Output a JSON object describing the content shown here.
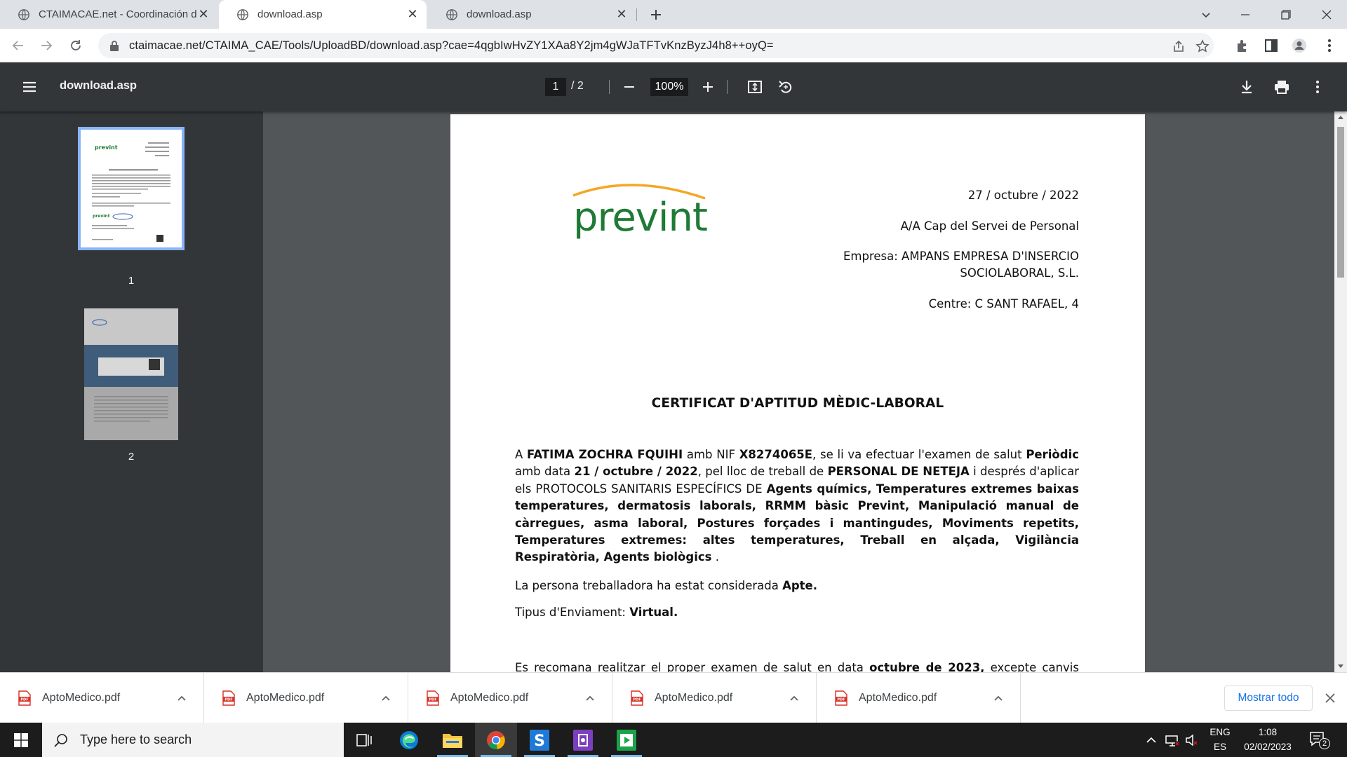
{
  "tabs": [
    {
      "title": "CTAIMACAE.net - Coordinación de Actividades Empresariales",
      "active": false
    },
    {
      "title": "download.asp",
      "active": true
    },
    {
      "title": "download.asp",
      "active": false
    }
  ],
  "address_bar": {
    "url": "ctaimacae.net/CTAIMA_CAE/Tools/UploadBD/download.asp?cae=4qgbIwHvZY1XAa8Y2jm4gWJaTFTvKnzByzJ4h8++oyQ="
  },
  "pdf_viewer": {
    "title": "download.asp",
    "current_page": "1",
    "total_pages": "/  2",
    "zoom": "100%",
    "thumbnails": [
      {
        "label": "1",
        "selected": true
      },
      {
        "label": "2",
        "selected": false
      }
    ]
  },
  "document": {
    "logo_text": "prevint",
    "date": "27 / octubre / 2022",
    "attention": "A/A Cap del Servei de Personal",
    "company_line1": "Empresa: AMPANS EMPRESA D'INSERCIO",
    "company_line2": "SOCIOLABORAL, S.L.",
    "centre": "Centre: C SANT RAFAEL, 4",
    "heading": "CERTIFICAT D'APTITUD MÈDIC-LABORAL",
    "p1": {
      "t1": "A ",
      "worker": "FATIMA ZOCHRA FQUIHI",
      "t2": " amb NIF ",
      "nif": "X8274065E",
      "t3": ", se li va efectuar l'examen de salut ",
      "exam_type": "Periòdic",
      "t4": " amb data ",
      "exam_date": "21 / octubre / 2022",
      "t5": ", pel lloc de treball de ",
      "job": "PERSONAL DE NETEJA",
      "t6": " i després d'aplicar els PROTOCOLS SANITARIS ESPECÍFICS DE ",
      "protocols": "Agents químics, Temperatures extremes baixas temperatures, dermatosis laborals, RRMM bàsic Prevint, Manipulació manual de càrregues, asma laboral, Postures forçades i mantingudes, Moviments repetits, Temperatures extremes: altes temperatures, Treball en alçada, Vigilància Respiratòria, Agents biològics",
      "t7": " ."
    },
    "p2": {
      "text": "La persona treballadora ha estat considerada ",
      "result": "Apte."
    },
    "p3": {
      "text": "Tipus d'Enviament: ",
      "value": "Virtual."
    },
    "p4": {
      "text": "Es recomana realitzar el proper examen de salut en data ",
      "date": "octubre de 2023,",
      "tail": " excepte canvis significatius en les condicions de salut de la persona treballadora."
    }
  },
  "downloads": {
    "items": [
      "AptoMedico.pdf",
      "AptoMedico.pdf",
      "AptoMedico.pdf",
      "AptoMedico.pdf",
      "AptoMedico.pdf"
    ],
    "show_all": "Mostrar todo"
  },
  "taskbar": {
    "search_placeholder": "Type here to search",
    "lang_top": "ENG",
    "lang_bottom": "ES",
    "time": "1:08",
    "date": "02/02/2023",
    "notification_count": "2"
  },
  "colors": {
    "brand_green": "#1f7a36",
    "brand_orange": "#f5a623",
    "accent_blue": "#1a73e8"
  }
}
